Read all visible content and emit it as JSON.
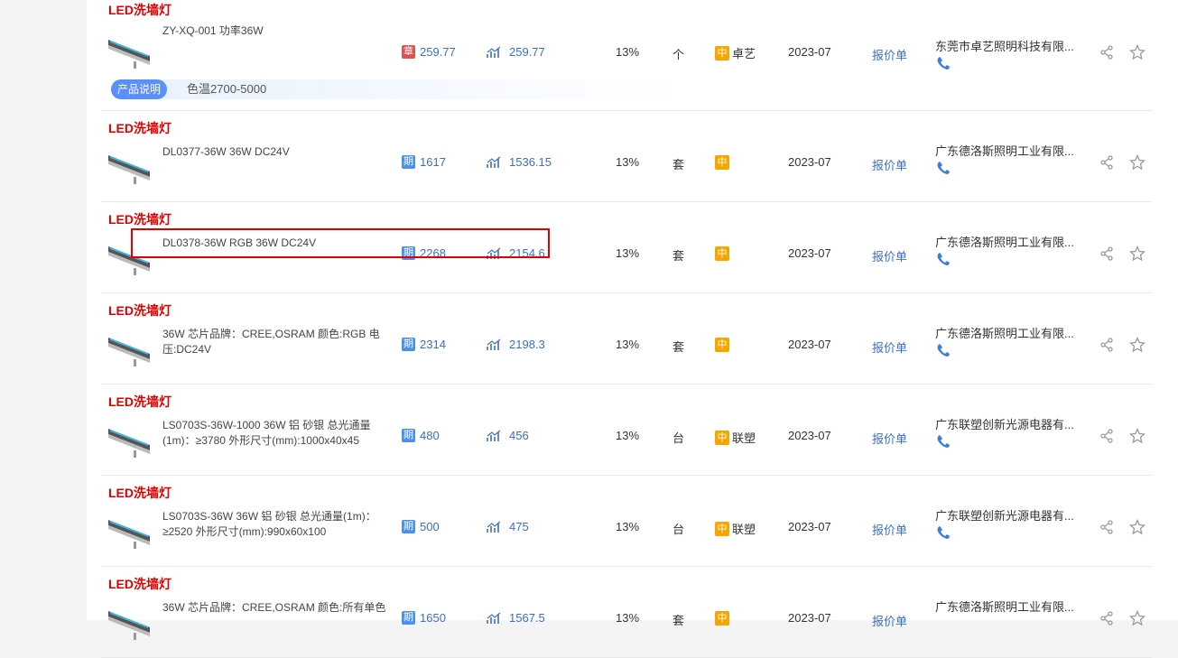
{
  "columns_hint": "product list",
  "description_tag": "产品说明",
  "description_text": "色温2700-5000",
  "rows": [
    {
      "name": "LED洗墙灯",
      "spec": "ZY-XQ-001 功率36W",
      "badge1": "章",
      "badge1_color": "#e05252",
      "price1": "259.77",
      "price2": "259.77",
      "tax": "13%",
      "unit": "个",
      "level": "中",
      "brand": "卓艺",
      "date": "2023-07",
      "quote": "报价单",
      "supplier": "东莞市卓艺照明科技有限..."
    },
    {
      "name": "LED洗墙灯",
      "spec": "DL0377-36W 36W DC24V",
      "badge1": "期",
      "badge1_color": "#4a90f0",
      "price1": "1617",
      "price2": "1536.15",
      "tax": "13%",
      "unit": "套",
      "level": "中",
      "brand": "",
      "date": "2023-07",
      "quote": "报价单",
      "supplier": "广东德洛斯照明工业有限..."
    },
    {
      "name": "LED洗墙灯",
      "spec": "DL0378-36W RGB 36W DC24V",
      "badge1": "期",
      "badge1_color": "#4a90f0",
      "price1": "2268",
      "price2": "2154.6",
      "tax": "13%",
      "unit": "套",
      "level": "中",
      "brand": "",
      "date": "2023-07",
      "quote": "报价单",
      "supplier": "广东德洛斯照明工业有限..."
    },
    {
      "name": "LED洗墙灯",
      "spec": "36W 芯片品牌：CREE,OSRAM 颜色:RGB 电压:DC24V",
      "badge1": "期",
      "badge1_color": "#4a90f0",
      "price1": "2314",
      "price2": "2198.3",
      "tax": "13%",
      "unit": "套",
      "level": "中",
      "brand": "",
      "date": "2023-07",
      "quote": "报价单",
      "supplier": "广东德洛斯照明工业有限..."
    },
    {
      "name": "LED洗墙灯",
      "spec": "LS0703S-36W-1000 36W 铝 砂银 总光通量(1m)：≥3780 外形尺寸(mm):1000x40x45",
      "badge1": "期",
      "badge1_color": "#4a90f0",
      "price1": "480",
      "price2": "456",
      "tax": "13%",
      "unit": "台",
      "level": "中",
      "brand": "联塑",
      "date": "2023-07",
      "quote": "报价单",
      "supplier": "广东联塑创新光源电器有..."
    },
    {
      "name": "LED洗墙灯",
      "spec": "LS0703S-36W 36W 铝 砂银 总光通量(1m)：≥2520 外形尺寸(mm):990x60x100",
      "badge1": "期",
      "badge1_color": "#4a90f0",
      "price1": "500",
      "price2": "475",
      "tax": "13%",
      "unit": "台",
      "level": "中",
      "brand": "联塑",
      "date": "2023-07",
      "quote": "报价单",
      "supplier": "广东联塑创新光源电器有..."
    },
    {
      "name": "LED洗墙灯",
      "spec": "36W 芯片品牌：CREE,OSRAM 颜色:所有单色",
      "badge1": "期",
      "badge1_color": "#4a90f0",
      "price1": "1650",
      "price2": "1567.5",
      "tax": "13%",
      "unit": "套",
      "level": "中",
      "brand": "",
      "date": "2023-07",
      "quote": "报价单",
      "supplier": "广东德洛斯照明工业有限..."
    }
  ],
  "colors": {
    "accent_red": "#e00000",
    "link_blue": "#3b6fc4",
    "level_orange": "#f7a600"
  }
}
